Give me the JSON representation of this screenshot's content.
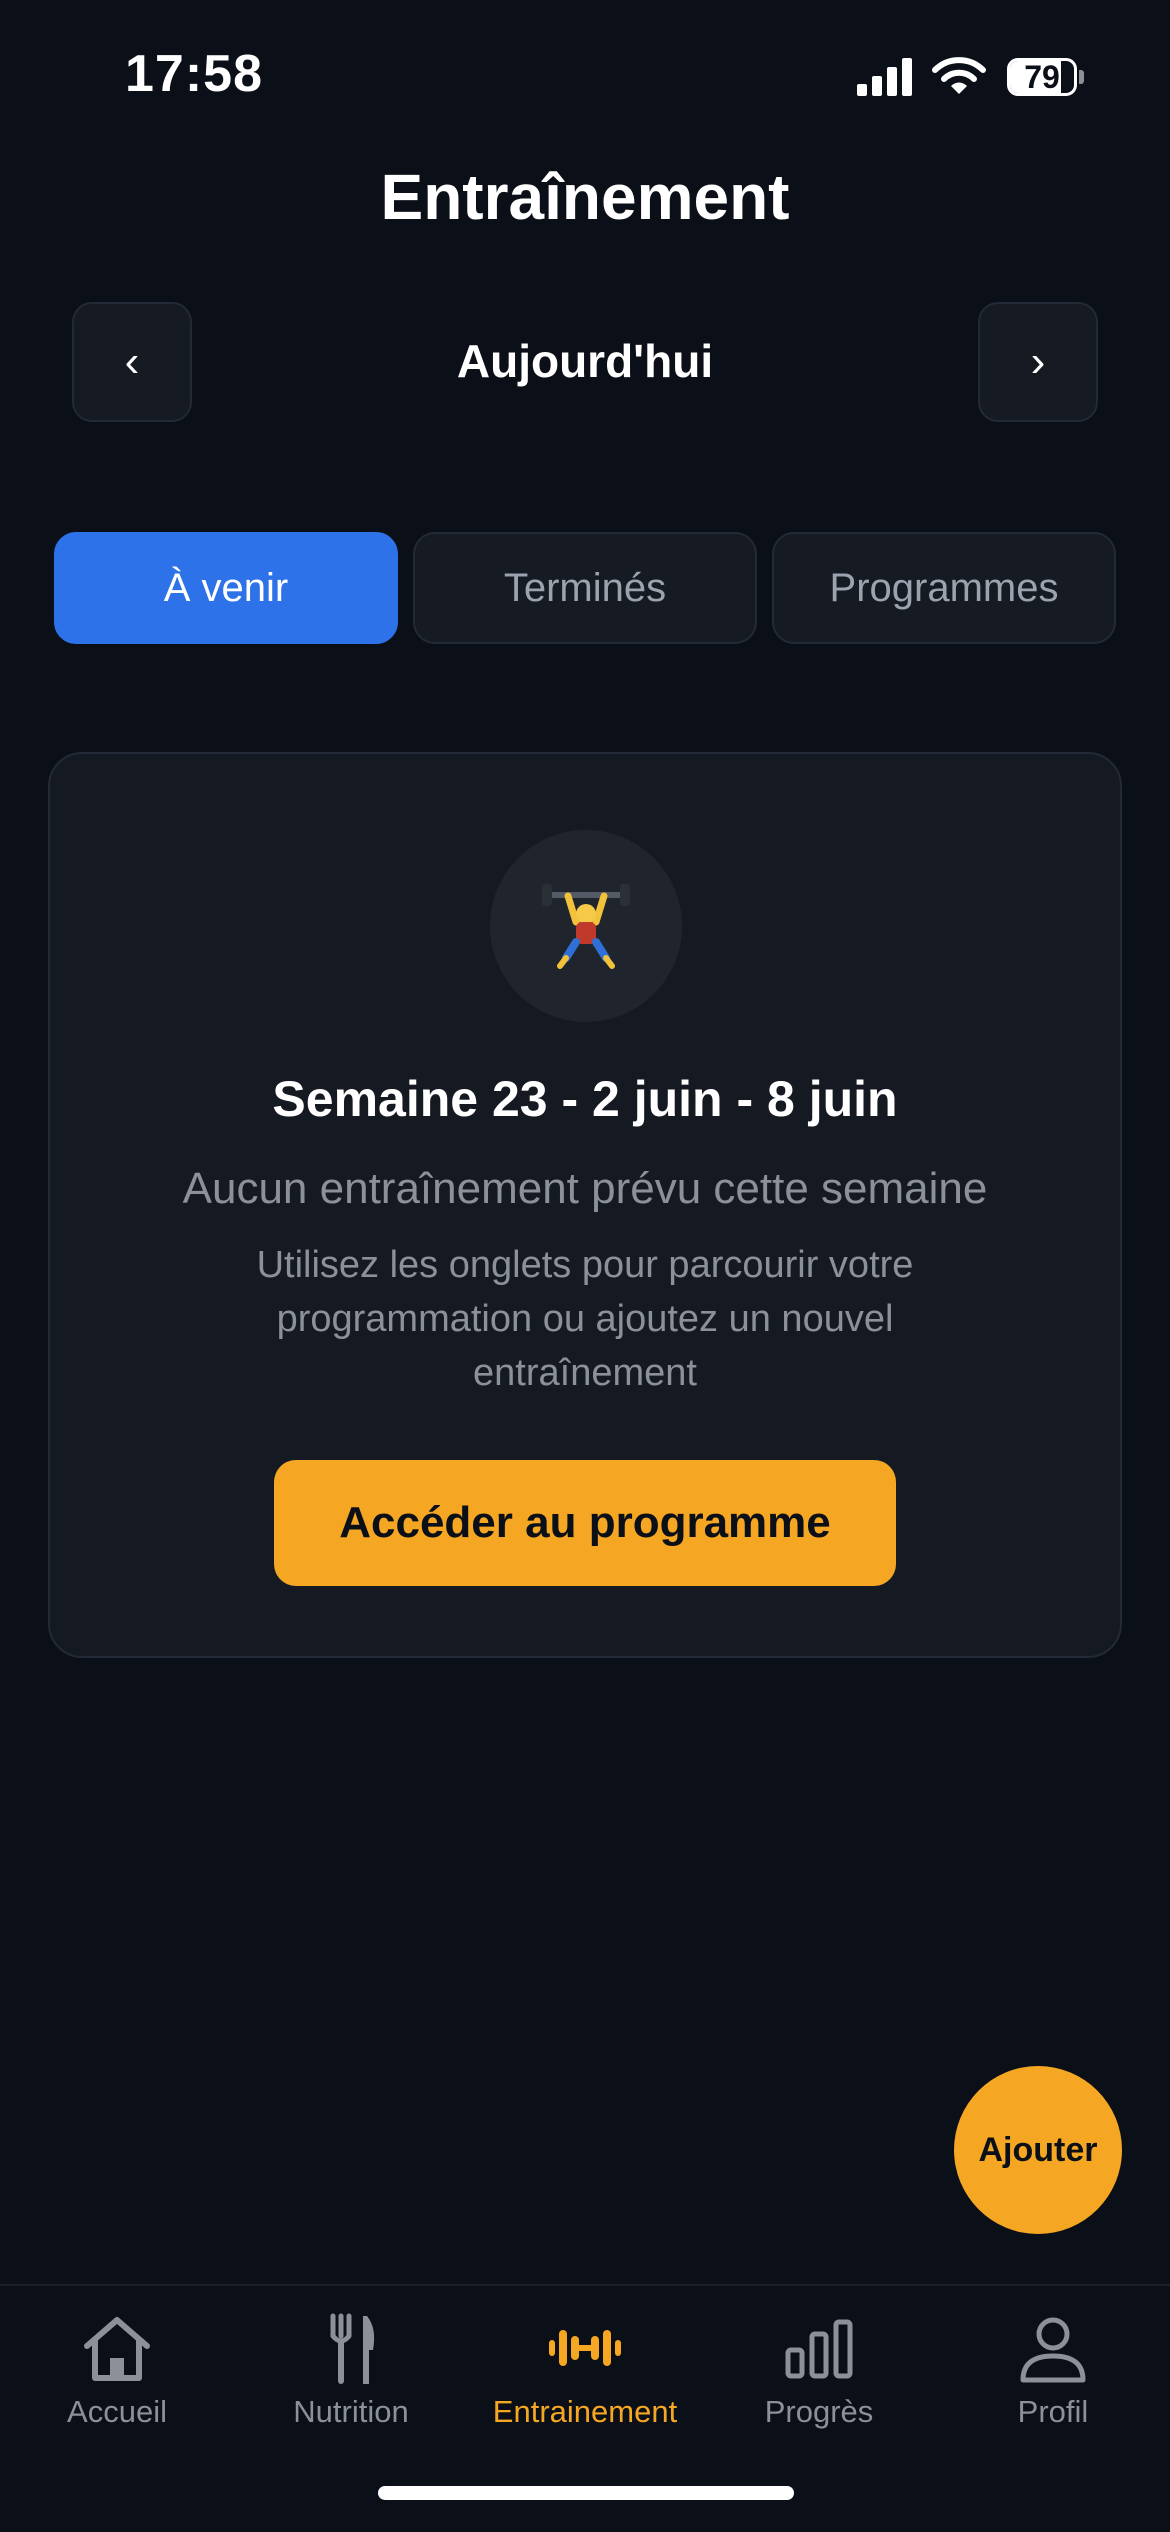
{
  "status_bar": {
    "time": "17:58",
    "battery_level": "79",
    "battery_fraction": 0.79,
    "icons": [
      "cellular-signal-icon",
      "wifi-icon",
      "battery-icon"
    ]
  },
  "header": {
    "title": "Entraînement",
    "date_label": "Aujourd'hui",
    "prev_label": "‹",
    "next_label": "›"
  },
  "tabs": [
    {
      "label": "À venir",
      "active": true
    },
    {
      "label": "Terminés",
      "active": false
    },
    {
      "label": "Programmes",
      "active": false
    }
  ],
  "empty_state": {
    "icon": "weightlifter-icon",
    "title": "Semaine 23 - 2 juin - 8 juin",
    "subtitle": "Aucun entraînement prévu cette semaine",
    "description": "Utilisez les onglets pour parcourir votre programmation ou ajoutez un nouvel entraînement",
    "button_label": "Accéder au programme"
  },
  "fab": {
    "label": "Ajouter"
  },
  "tab_bar": {
    "items": [
      {
        "label": "Accueil",
        "icon": "home-icon",
        "active": false
      },
      {
        "label": "Nutrition",
        "icon": "fork-knife-icon",
        "active": false
      },
      {
        "label": "Entrainement",
        "icon": "dumbbell-icon",
        "active": true
      },
      {
        "label": "Progrès",
        "icon": "bar-chart-icon",
        "active": false
      },
      {
        "label": "Profil",
        "icon": "person-icon",
        "active": false
      }
    ]
  },
  "colors": {
    "background": "#0b0f17",
    "card": "#151a22",
    "accent_blue": "#2d72e8",
    "accent_orange": "#f5a623",
    "muted_text": "#8b9099"
  }
}
